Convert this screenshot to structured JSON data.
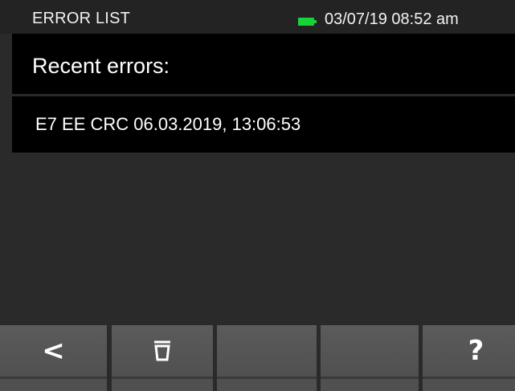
{
  "status_bar": {
    "title": "ERROR LIST",
    "datetime": "03/07/19 08:52 am",
    "battery_icon": "battery-full-icon",
    "battery_color": "#18d23a"
  },
  "header": {
    "title": "Recent errors:"
  },
  "errors": [
    {
      "text": "E7 EE CRC 06.03.2019, 13:06:53"
    }
  ],
  "toolbar": {
    "buttons": [
      {
        "icon": "chevron-left-icon",
        "label": "<"
      },
      {
        "icon": "trash-icon",
        "label": ""
      },
      {
        "icon": "",
        "label": ""
      },
      {
        "icon": "",
        "label": ""
      },
      {
        "icon": "help-icon",
        "label": "?"
      }
    ]
  }
}
